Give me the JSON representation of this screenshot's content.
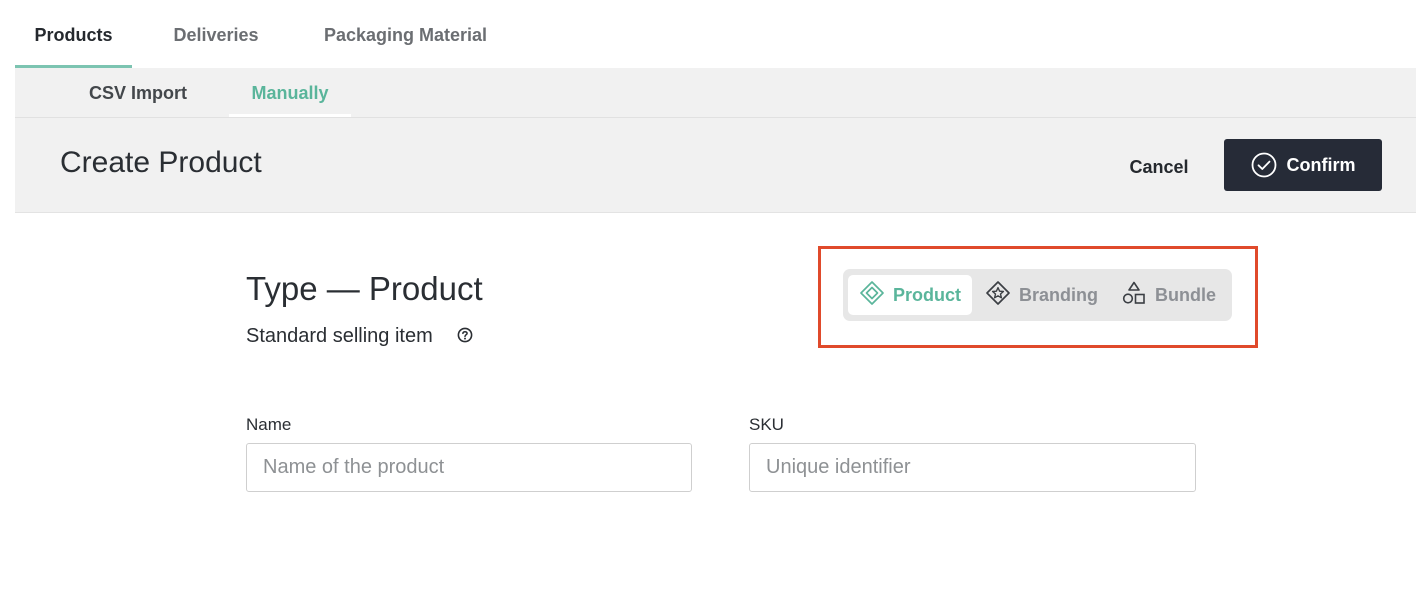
{
  "tabs": [
    {
      "label": "Products",
      "active": true
    },
    {
      "label": "Deliveries",
      "active": false
    },
    {
      "label": "Packaging Material",
      "active": false
    }
  ],
  "subtabs": [
    {
      "label": "CSV Import",
      "active": false
    },
    {
      "label": "Manually",
      "active": true
    }
  ],
  "header": {
    "title": "Create Product",
    "cancel_label": "Cancel",
    "confirm_label": "Confirm",
    "confirm_icon": "check-circle-icon"
  },
  "type_section": {
    "title": "Type — Product",
    "subtitle": "Standard selling item",
    "help_icon": "help-circle-icon"
  },
  "type_options": [
    {
      "label": "Product",
      "icon": "diamond-icon",
      "selected": true
    },
    {
      "label": "Branding",
      "icon": "diamond-star-icon",
      "selected": false
    },
    {
      "label": "Bundle",
      "icon": "shapes-icon",
      "selected": false
    }
  ],
  "form": {
    "name": {
      "label": "Name",
      "placeholder": "Name of the product",
      "value": ""
    },
    "sku": {
      "label": "SKU",
      "placeholder": "Unique identifier",
      "value": ""
    }
  },
  "colors": {
    "accent": "#5ab59b",
    "tab_underline": "#7cc4b1",
    "confirm_bg": "#262b37",
    "highlight": "#e04a2b"
  }
}
